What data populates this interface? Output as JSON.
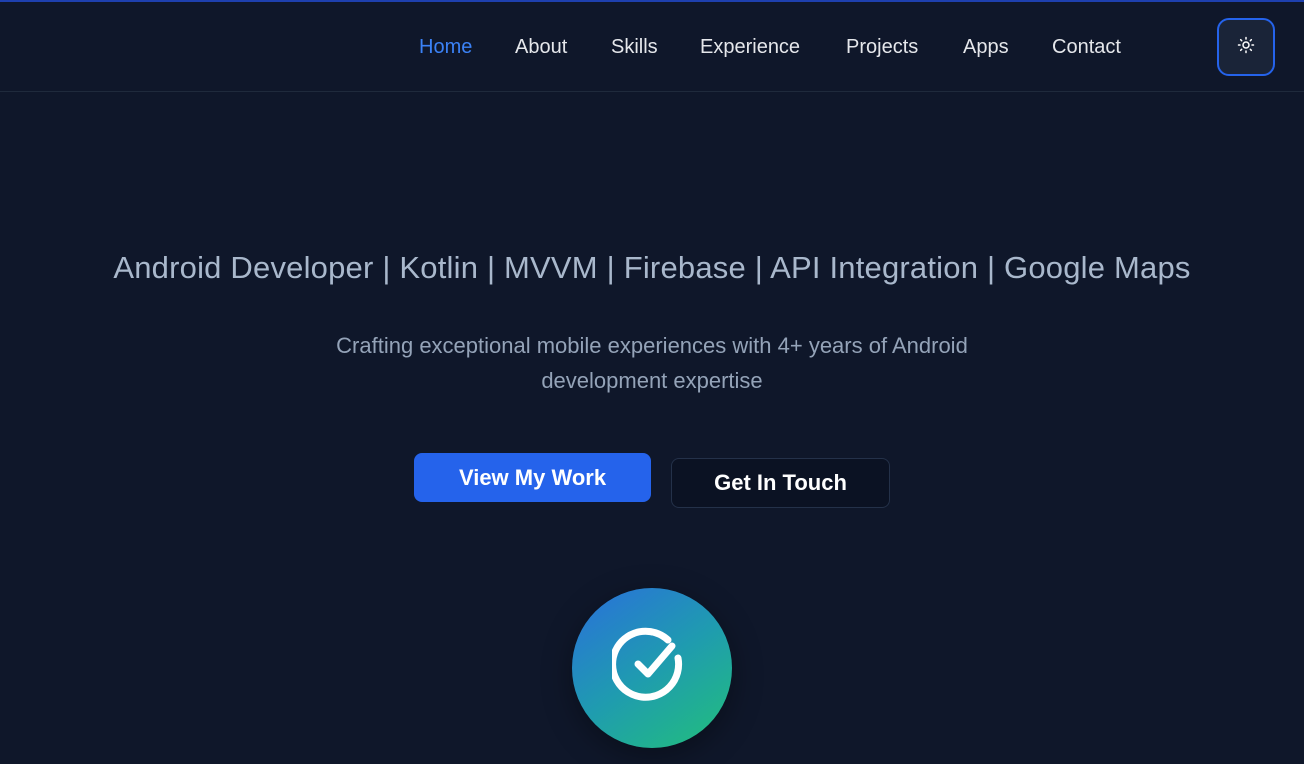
{
  "nav": {
    "items": [
      {
        "label": "Home",
        "active": true
      },
      {
        "label": "About",
        "active": false
      },
      {
        "label": "Skills",
        "active": false
      },
      {
        "label": "Experience",
        "active": false
      },
      {
        "label": "Projects",
        "active": false
      },
      {
        "label": "Apps",
        "active": false
      },
      {
        "label": "Contact",
        "active": false
      }
    ],
    "theme_toggle_icon": "sun-icon"
  },
  "hero": {
    "tagline": "Android Developer | Kotlin | MVVM | Firebase | API Integration | Google Maps",
    "subtitle": "Crafting exceptional mobile experiences with 4+ years of Android development expertise",
    "primary_button": "View My Work",
    "secondary_button": "Get In Touch",
    "badge_icon": "check-circle-icon"
  },
  "colors": {
    "background": "#0f172a",
    "accent": "#2563eb",
    "active_link": "#3b82f6",
    "badge_gradient": [
      "#2a6fdc",
      "#22c07a"
    ]
  }
}
